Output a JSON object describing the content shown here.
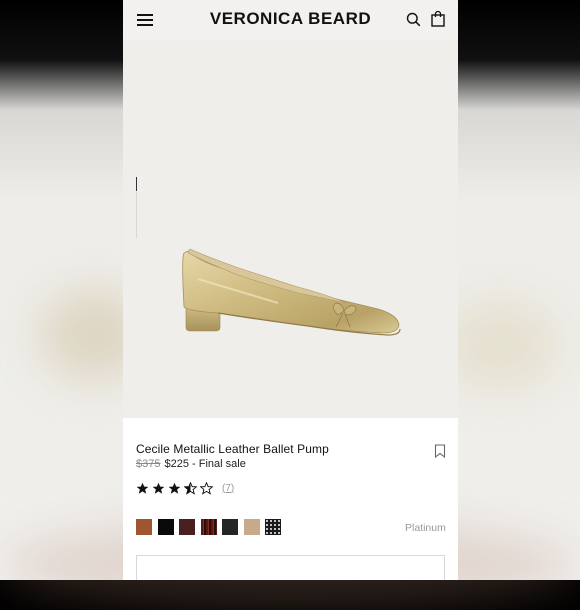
{
  "header": {
    "brand": "VERONICA BEARD",
    "menu_icon": "hamburger-menu-icon",
    "search_icon": "search-icon",
    "bag_icon": "shopping-bag-icon"
  },
  "gallery": {
    "image_alt": "Cecile Metallic Leather Ballet Pump"
  },
  "product": {
    "title": "Cecile Metallic Leather Ballet Pump",
    "original_price": "$375",
    "sale_price": "$225",
    "sale_note": " - Final sale",
    "rating": 3.5,
    "rating_max": 5,
    "review_count": "(7)",
    "selected_color": "Platinum",
    "bookmark_icon": "bookmark-icon",
    "swatches": [
      {
        "color": "#a0542f"
      },
      {
        "color": "#0a0a0a"
      },
      {
        "color": "#4a1f22"
      },
      {
        "color": "#5a1a14"
      },
      {
        "color": "#252525"
      },
      {
        "color": "#c8a98a"
      },
      {
        "color": "#1a1a1a"
      }
    ]
  },
  "colors": {
    "accent": "#111111",
    "muted": "#999999",
    "gallery_bg": "#efeeea"
  }
}
